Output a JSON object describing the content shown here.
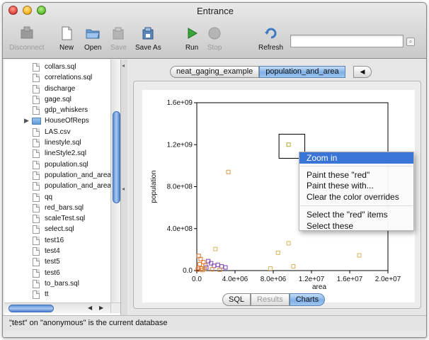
{
  "window": {
    "title": "Entrance"
  },
  "toolbar": {
    "disconnect": "Disconnect",
    "new": "New",
    "open": "Open",
    "save": "Save",
    "save_as": "Save As",
    "run": "Run",
    "stop": "Stop",
    "refresh": "Refresh",
    "search_value": ""
  },
  "sidebar": {
    "items": [
      {
        "label": "collars.sql",
        "type": "file"
      },
      {
        "label": "correlations.sql",
        "type": "file"
      },
      {
        "label": "discharge",
        "type": "file"
      },
      {
        "label": "gage.sql",
        "type": "file"
      },
      {
        "label": "gdp_whiskers",
        "type": "file"
      },
      {
        "label": "HouseOfReps",
        "type": "folder"
      },
      {
        "label": "LAS.csv",
        "type": "file"
      },
      {
        "label": "linestyle.sql",
        "type": "file"
      },
      {
        "label": "lineStyle2.sql",
        "type": "file"
      },
      {
        "label": "population.sql",
        "type": "file"
      },
      {
        "label": "population_and_area",
        "type": "file"
      },
      {
        "label": "population_and_area",
        "type": "file"
      },
      {
        "label": "qq",
        "type": "file"
      },
      {
        "label": "red_bars.sql",
        "type": "file"
      },
      {
        "label": "scaleTest.sql",
        "type": "file"
      },
      {
        "label": "select.sql",
        "type": "file"
      },
      {
        "label": "test16",
        "type": "file"
      },
      {
        "label": "test4",
        "type": "file"
      },
      {
        "label": "test5",
        "type": "file"
      },
      {
        "label": "test6",
        "type": "file"
      },
      {
        "label": "to_bars.sql",
        "type": "file"
      },
      {
        "label": "tt",
        "type": "file"
      }
    ]
  },
  "tabs": [
    {
      "label": "neat_gaging_example",
      "active": false
    },
    {
      "label": "population_and_area",
      "active": true
    }
  ],
  "view_switch": [
    {
      "label": "SQL",
      "state": "normal"
    },
    {
      "label": "Results",
      "state": "disabled"
    },
    {
      "label": "Charts",
      "state": "active"
    }
  ],
  "chart_data": {
    "type": "scatter",
    "xlabel": "area",
    "ylabel": "population",
    "xlim": [
      0,
      20000000
    ],
    "ylim": [
      0,
      1600000000
    ],
    "xticks": [
      "0.0",
      "4.0e+06",
      "8.0e+06",
      "1.2e+07",
      "1.6e+07",
      "2.0e+07"
    ],
    "yticks": [
      "0.0",
      "4.0e+08",
      "8.0e+08",
      "1.2e+09",
      "1.6e+09"
    ],
    "grid": false,
    "marker": "open-square",
    "selection_box": {
      "x0": 8600000,
      "x1": 11300000,
      "y0": 1070000000,
      "y1": 1300000000
    },
    "points": [
      {
        "x": 9600000,
        "y": 1200000000,
        "color": "#b5a637"
      },
      {
        "x": 3300000,
        "y": 940000000,
        "color": "#d79a4a"
      },
      {
        "x": 9600000,
        "y": 260000000,
        "color": "#d7b45a"
      },
      {
        "x": 8500000,
        "y": 170000000,
        "color": "#d7b45a"
      },
      {
        "x": 17000000,
        "y": 145000000,
        "color": "#d7b45a"
      },
      {
        "x": 1950000,
        "y": 205000000,
        "color": "#d7b45a"
      },
      {
        "x": 10100000,
        "y": 40000000,
        "color": "#d7b45a"
      },
      {
        "x": 7700000,
        "y": 20000000,
        "color": "#d7b45a"
      },
      {
        "x": 200000,
        "y": 140000000,
        "color": "#e07030"
      },
      {
        "x": 400000,
        "y": 110000000,
        "color": "#e07030"
      },
      {
        "x": 700000,
        "y": 80000000,
        "color": "#e07030"
      },
      {
        "x": 300000,
        "y": 60000000,
        "color": "#e07030"
      },
      {
        "x": 900000,
        "y": 50000000,
        "color": "#d48a3a"
      },
      {
        "x": 1200000,
        "y": 90000000,
        "color": "#7a3fb0"
      },
      {
        "x": 1500000,
        "y": 70000000,
        "color": "#7a3fb0"
      },
      {
        "x": 1800000,
        "y": 45000000,
        "color": "#7a3fb0"
      },
      {
        "x": 2200000,
        "y": 55000000,
        "color": "#7a3fb0"
      },
      {
        "x": 2600000,
        "y": 40000000,
        "color": "#7a3fb0"
      },
      {
        "x": 1000000,
        "y": 30000000,
        "color": "#7a3fb0"
      },
      {
        "x": 150000,
        "y": 25000000,
        "color": "#e07030"
      },
      {
        "x": 500000,
        "y": 20000000,
        "color": "#e07030"
      },
      {
        "x": 800000,
        "y": 15000000,
        "color": "#d48a3a"
      },
      {
        "x": 1600000,
        "y": 12000000,
        "color": "#d48a3a"
      },
      {
        "x": 2400000,
        "y": 8000000,
        "color": "#d48a3a"
      },
      {
        "x": 100000,
        "y": 10000000,
        "color": "#e07030"
      },
      {
        "x": 600000,
        "y": 5000000,
        "color": "#d48a3a"
      },
      {
        "x": 3000000,
        "y": 30000000,
        "color": "#7a3fb0"
      }
    ]
  },
  "context_menu": {
    "items": [
      {
        "label": "Zoom in",
        "highlighted": true
      },
      {
        "label": "Paint these \"red\"",
        "highlighted": false
      },
      {
        "label": "Paint these with...",
        "highlighted": false
      },
      {
        "label": "Clear the color overrides",
        "highlighted": false
      },
      {
        "label": "Select the \"red\" items",
        "highlighted": false
      },
      {
        "label": "Select these",
        "highlighted": false
      }
    ]
  },
  "status": {
    "text": "\"test\" on \"anonymous\" is the current database"
  },
  "colors": {
    "accent": "#3875d7",
    "selection_tab": "#7fb0e7"
  }
}
